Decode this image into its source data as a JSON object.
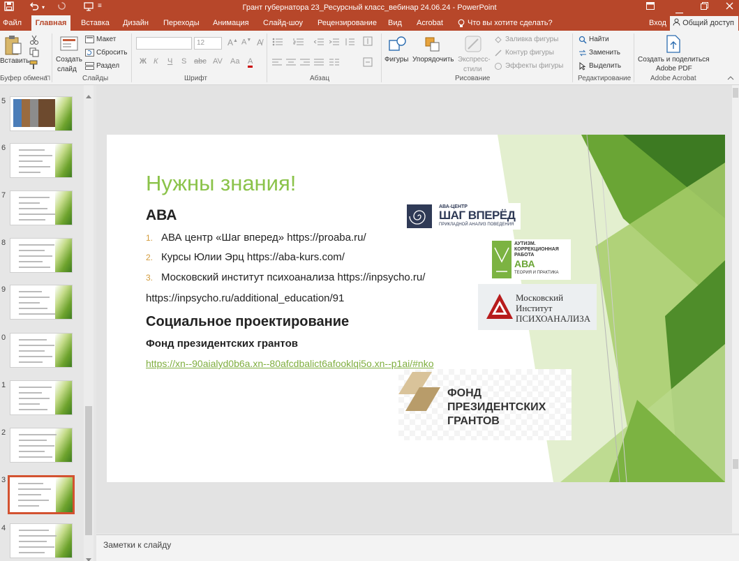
{
  "window": {
    "title": "Грант губернатора 23_Ресурсный класс_вебинар 24.06.24 - PowerPoint"
  },
  "menu": {
    "tabs": [
      "Файл",
      "Главная",
      "Вставка",
      "Дизайн",
      "Переходы",
      "Анимация",
      "Слайд-шоу",
      "Рецензирование",
      "Вид",
      "Acrobat"
    ],
    "tell_me": "Что вы хотите сделать?",
    "login": "Вход",
    "share": "Общий доступ"
  },
  "ribbon": {
    "paste": "Вставить",
    "clipboard": "Буфер обмена",
    "new_slide": "Создать",
    "new_slide2": "слайд",
    "layout": "Макет",
    "reset": "Сбросить",
    "section": "Раздел",
    "slides": "Слайды",
    "font_size": "12",
    "font_group": "Шрифт",
    "paragraph": "Абзац",
    "shapes": "Фигуры",
    "arrange": "Упорядочить",
    "quick_styles": "Экспресс-",
    "quick_styles2": "стили",
    "fill": "Заливка фигуры",
    "outline": "Контур фигуры",
    "effects": "Эффекты фигуры",
    "drawing": "Рисование",
    "find": "Найти",
    "replace": "Заменить",
    "select": "Выделить",
    "editing": "Редактирование",
    "acrobat_btn": "Создать и поделиться",
    "acrobat_btn2": "Adobe PDF",
    "acrobat_group": "Adobe Acrobat"
  },
  "thumbnails": [
    {
      "num": "5"
    },
    {
      "num": "6"
    },
    {
      "num": "7"
    },
    {
      "num": "8"
    },
    {
      "num": "9"
    },
    {
      "num": "0"
    },
    {
      "num": "1"
    },
    {
      "num": "2"
    },
    {
      "num": "3"
    },
    {
      "num": "4"
    }
  ],
  "slide": {
    "title": "Нужны знания!",
    "aba_heading": "АВА",
    "items": [
      {
        "num": "1.",
        "text": "АВА центр «Шаг вперед» https://proaba.ru/"
      },
      {
        "num": "2.",
        "text": "Курсы Юлии Эрц https://aba-kurs.com/"
      },
      {
        "num": "3.",
        "text": "Московский институт психоанализа  https://inpsycho.ru/"
      }
    ],
    "extra_line": "https://inpsycho.ru/additional_education/91",
    "social_heading": "Социальное проектирование",
    "fund_heading": "Фонд президентских грантов",
    "fund_link": "https://xn--90aialyd0b6a.xn--80afcdbalict6afooklqi5o.xn--p1ai/#nko",
    "logo_shag_top": "АВА-ЦЕНТР",
    "logo_shag_main": "ШАГ ВПЕРЁД",
    "logo_shag_sub": "ПРИКЛАДНОЙ АНАЛИЗ ПОВЕДЕНИЯ",
    "logo_aba_l1": "АУТИЗМ.",
    "logo_aba_l2": "КОРРЕКЦИОННАЯ",
    "logo_aba_l3": "РАБОТА",
    "logo_aba_l4": "АВА",
    "logo_aba_l5": "ТЕОРИЯ И ПРАКТИКА",
    "logo_mip_l1": "Московский",
    "logo_mip_l2": "Институт",
    "logo_mip_l3": "ПСИХОАНАЛИЗА",
    "logo_fpg_l1": "ФОНД",
    "logo_fpg_l2": "ПРЕЗИДЕНТСКИХ",
    "logo_fpg_l3": "ГРАНТОВ"
  },
  "notes": {
    "placeholder": "Заметки к слайду"
  },
  "colors": {
    "accent": "#b7472a",
    "title_green": "#8bc34a",
    "link_green": "#7fae3f",
    "selected_thumb": "#d35230"
  }
}
